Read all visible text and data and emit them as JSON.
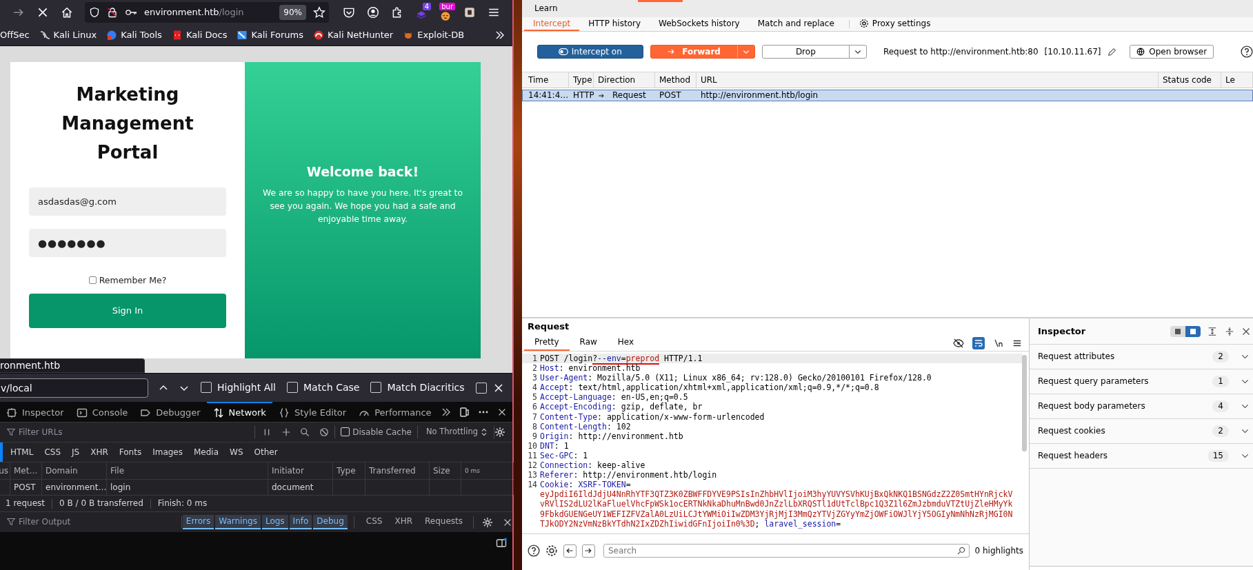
{
  "browser": {
    "address": {
      "host": "environment.htb",
      "path": "/login",
      "zoom": "90%"
    },
    "extension_badges": [
      "4",
      "bur"
    ],
    "bookmarks": [
      {
        "label": "OffSec",
        "kind": "plain"
      },
      {
        "label": "Kali Linux",
        "kind": "dragon"
      },
      {
        "label": "Kali Tools",
        "kind": "tools"
      },
      {
        "label": "Kali Docs",
        "kind": "docs"
      },
      {
        "label": "Kali Forums",
        "kind": "forums"
      },
      {
        "label": "Kali NetHunter",
        "kind": "nethunter"
      },
      {
        "label": "Exploit-DB",
        "kind": "bug"
      }
    ],
    "page": {
      "title": "Marketing Management Portal",
      "email": "asdasdas@g.com",
      "password": "●●●●●●●",
      "remember": {
        "label": "Remember Me?",
        "checked": false
      },
      "sign_in": "Sign In",
      "welcome_title": "Welcome back!",
      "welcome_text": "We are so happy to have you here. It's great to see you again. We hope you had a safe and enjoyable time away."
    },
    "status_link": "ronment.htb"
  },
  "find_bar": {
    "value": "v/local",
    "options": [
      {
        "label": "Highlight All",
        "checked": false
      },
      {
        "label": "Match Case",
        "checked": false
      },
      {
        "label": "Match Diacritics",
        "checked": false
      },
      {
        "checked": false
      }
    ]
  },
  "devtools": {
    "tabs": [
      {
        "label": "Inspector",
        "kind": "inspector",
        "selected": false
      },
      {
        "label": "Console",
        "kind": "console",
        "selected": false
      },
      {
        "label": "Debugger",
        "kind": "debugger",
        "selected": false
      },
      {
        "label": "Network",
        "kind": "network",
        "selected": true
      },
      {
        "label": "Style Editor",
        "kind": "style",
        "selected": false
      },
      {
        "label": "Performance",
        "kind": "performance",
        "selected": false
      }
    ],
    "network": {
      "filter_placeholder": "Filter URLs",
      "disable_cache": {
        "label": "Disable Cache",
        "checked": false
      },
      "throttling": "No Throttling",
      "type_filters": [
        "HTML",
        "CSS",
        "JS",
        "XHR",
        "Fonts",
        "Images",
        "Media",
        "WS",
        "Other"
      ],
      "columns": [
        "us",
        "Met…",
        "Domain",
        "File",
        "Initiator",
        "Type",
        "Transferred",
        "Size",
        "0 ms"
      ],
      "rows": [
        {
          "method": "POST",
          "domain": "environment…",
          "file": "login",
          "initiator": "document"
        }
      ],
      "summary": [
        "1 request",
        "0 B / 0 B transferred",
        "Finish: 0 ms"
      ]
    },
    "console": {
      "filter_placeholder": "Filter Output",
      "filters": [
        {
          "label": "Errors",
          "selected": true
        },
        {
          "label": "Warnings",
          "selected": true
        },
        {
          "label": "Logs",
          "selected": true
        },
        {
          "label": "Info",
          "selected": true
        },
        {
          "label": "Debug",
          "selected": true
        },
        {
          "label": "CSS",
          "selected": false
        },
        {
          "label": "XHR",
          "selected": false
        },
        {
          "label": "Requests",
          "selected": false
        }
      ]
    }
  },
  "burp": {
    "menu": "Learn",
    "tabs": [
      {
        "label": "Intercept",
        "selected": true
      },
      {
        "label": "HTTP history",
        "selected": false
      },
      {
        "label": "WebSockets history",
        "selected": false
      },
      {
        "label": "Match and replace",
        "selected": false
      }
    ],
    "settings": "Proxy settings",
    "intercept": {
      "label": "Intercept on",
      "on": true
    },
    "forward": "Forward",
    "drop": "Drop",
    "target": "Request to http://environment.htb:80",
    "target_ip": "[10.10.11.67]",
    "open_browser": "Open browser",
    "history": {
      "columns": [
        "Time",
        "Type",
        "Direction",
        "Method",
        "URL",
        "Status code",
        "Le"
      ],
      "rows": [
        {
          "time": "14:41:4…",
          "type": "HTTP",
          "direction": "Request",
          "method": "POST",
          "url": "http://environment.htb/login",
          "selected": true
        }
      ]
    },
    "request": {
      "title": "Request",
      "tabs": [
        {
          "label": "Pretty",
          "selected": true
        },
        {
          "label": "Raw",
          "selected": false
        },
        {
          "label": "Hex",
          "selected": false
        }
      ],
      "lines": [
        {
          "number": "1",
          "current": true,
          "segments": [
            {
              "kind": "plain",
              "text": "POST /login"
            },
            {
              "kind": "marked",
              "parts": [
                {
                  "kind": "plain",
                  "text": "?"
                },
                {
                  "kind": "name",
                  "text": "--env"
                },
                {
                  "kind": "plain",
                  "text": "="
                },
                {
                  "kind": "value",
                  "text": "preprod"
                }
              ]
            },
            {
              "kind": "plain",
              "text": " HTTP/1.1"
            }
          ]
        },
        {
          "number": "2",
          "current": false,
          "segments": [
            {
              "kind": "name",
              "text": "Host"
            },
            {
              "kind": "plain",
              "text": ": environment.htb"
            }
          ]
        },
        {
          "number": "3",
          "current": false,
          "segments": [
            {
              "kind": "name",
              "text": "User-Agent"
            },
            {
              "kind": "plain",
              "text": ": Mozilla/5.0 (X11; Linux x86_64; rv:128.0) Gecko/20100101 Firefox/128.0"
            }
          ]
        },
        {
          "number": "4",
          "current": false,
          "segments": [
            {
              "kind": "name",
              "text": "Accept"
            },
            {
              "kind": "plain",
              "text": ": text/html,application/xhtml+xml,application/xml;q=0.9,*/*;q=0.8"
            }
          ]
        },
        {
          "number": "5",
          "current": false,
          "segments": [
            {
              "kind": "name",
              "text": "Accept-Language"
            },
            {
              "kind": "plain",
              "text": ": en-US,en;q=0.5"
            }
          ]
        },
        {
          "number": "6",
          "current": false,
          "segments": [
            {
              "kind": "name",
              "text": "Accept-Encoding"
            },
            {
              "kind": "plain",
              "text": ": gzip, deflate, br"
            }
          ]
        },
        {
          "number": "7",
          "current": false,
          "segments": [
            {
              "kind": "name",
              "text": "Content-Type"
            },
            {
              "kind": "plain",
              "text": ": application/x-www-form-urlencoded"
            }
          ]
        },
        {
          "number": "8",
          "current": false,
          "segments": [
            {
              "kind": "name",
              "text": "Content-Length"
            },
            {
              "kind": "plain",
              "text": ": 102"
            }
          ]
        },
        {
          "number": "9",
          "current": false,
          "segments": [
            {
              "kind": "name",
              "text": "Origin"
            },
            {
              "kind": "plain",
              "text": ": http://environment.htb"
            }
          ]
        },
        {
          "number": "10",
          "current": false,
          "segments": [
            {
              "kind": "name",
              "text": "DNT"
            },
            {
              "kind": "plain",
              "text": ": 1"
            }
          ]
        },
        {
          "number": "11",
          "current": false,
          "segments": [
            {
              "kind": "name",
              "text": "Sec-GPC"
            },
            {
              "kind": "plain",
              "text": ": 1"
            }
          ]
        },
        {
          "number": "12",
          "current": false,
          "segments": [
            {
              "kind": "name",
              "text": "Connection"
            },
            {
              "kind": "plain",
              "text": ": keep-alive"
            }
          ]
        },
        {
          "number": "13",
          "current": false,
          "segments": [
            {
              "kind": "name",
              "text": "Referer"
            },
            {
              "kind": "plain",
              "text": ": http://environment.htb/login"
            }
          ]
        },
        {
          "number": "14",
          "current": false,
          "segments": [
            {
              "kind": "name",
              "text": "Cookie"
            },
            {
              "kind": "plain",
              "text": ": "
            },
            {
              "kind": "name",
              "text": "XSRF-TOKEN"
            },
            {
              "kind": "plain",
              "text": "="
            }
          ]
        },
        {
          "current": false,
          "segments": [
            {
              "kind": "value",
              "text": "eyJpdiI6IldJdjU4NnRhYTF3QTZ3K0ZBWFFDYVE9PSIsInZhbHVlIjoiM3hyYUVYSVhKUjBxQkNKQ1BSNGdzZ2Z0SmtHYnRjckV"
            }
          ]
        },
        {
          "current": false,
          "segments": [
            {
              "kind": "value",
              "text": "vRVlIS2dLU2lKaFluelVhcFpWSk1ocERTNkNkaDhuMnBwd0JnZzlLbXRQSTl1dUtTclBpc1Q3Z1l6ZmJzbmduVTZtUjZleHMyYk"
            }
          ]
        },
        {
          "current": false,
          "segments": [
            {
              "kind": "value",
              "text": "9FbkdGUENGeUY1WEFIZFVZalA0LzUiLCJtYWMiOiIwZDM3YjRjMjI3MmQzYTVjZGYyYmZjOWFiOWJlYjY5OGIyNmNhNzRjMGI0N"
            }
          ]
        },
        {
          "current": false,
          "segments": [
            {
              "kind": "value",
              "text": "TJkODY2NzVmNzBkYTdhN2IxZDZhIiwidGFnIjoiIn0%3D"
            },
            {
              "kind": "plain",
              "text": "; "
            },
            {
              "kind": "name",
              "text": "laravel_session"
            },
            {
              "kind": "plain",
              "text": "="
            }
          ]
        }
      ],
      "search_placeholder": "Search",
      "highlights": "0 highlights"
    },
    "inspector": {
      "title": "Inspector",
      "sections": [
        {
          "label": "Request attributes",
          "count": "2"
        },
        {
          "label": "Request query parameters",
          "count": "1"
        },
        {
          "label": "Request body parameters",
          "count": "4"
        },
        {
          "label": "Request cookies",
          "count": "2"
        },
        {
          "label": "Request headers",
          "count": "15"
        }
      ]
    }
  }
}
